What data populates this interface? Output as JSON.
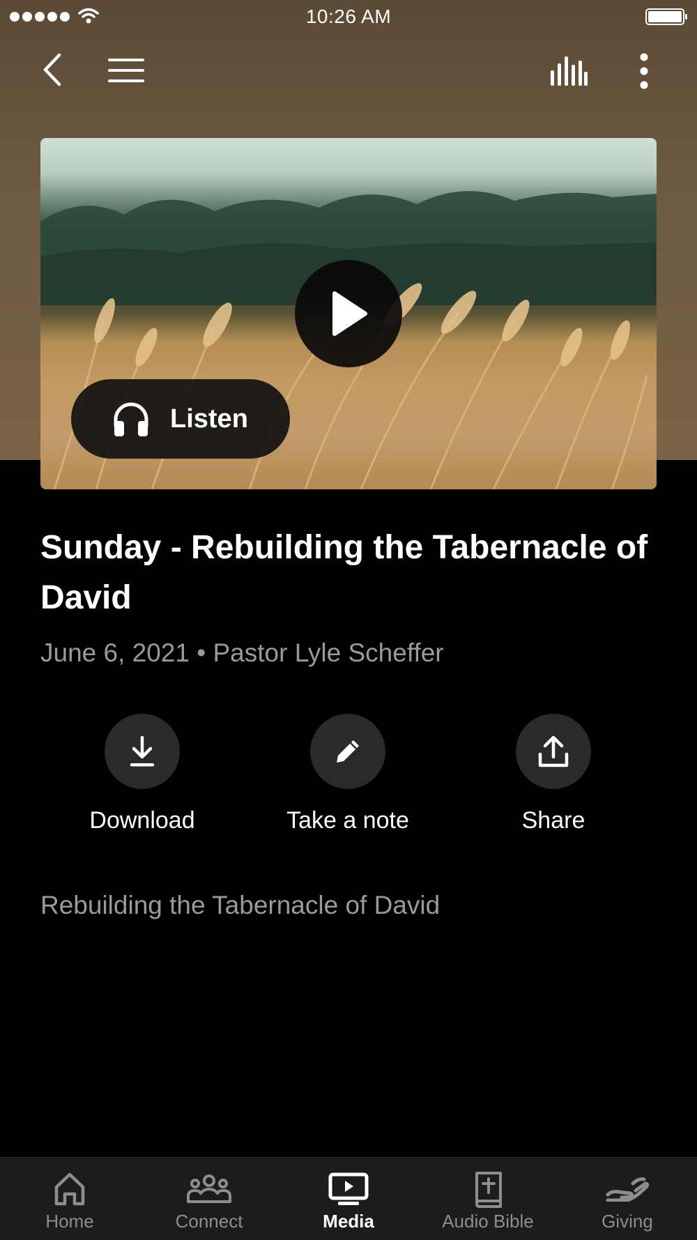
{
  "status_bar": {
    "time": "10:26 AM"
  },
  "top_nav": {
    "back_icon": "chevron-left-icon",
    "menu_icon": "hamburger-icon",
    "audio_icon": "audio-bars-icon",
    "more_icon": "more-vertical-icon"
  },
  "media": {
    "play_icon": "play-icon",
    "listen_label": "Listen",
    "listen_icon": "headphones-icon"
  },
  "sermon": {
    "title": "Sunday - Rebuilding the Tabernacle of David",
    "date": "June 6, 2021",
    "separator": "•",
    "speaker": "Pastor Lyle Scheffer",
    "description": "Rebuilding the Tabernacle of David"
  },
  "actions": [
    {
      "label": "Download",
      "icon": "download-icon"
    },
    {
      "label": "Take a note",
      "icon": "pencil-icon"
    },
    {
      "label": "Share",
      "icon": "share-icon"
    }
  ],
  "tabs": [
    {
      "label": "Home",
      "icon": "home-icon",
      "active": false
    },
    {
      "label": "Connect",
      "icon": "people-icon",
      "active": false
    },
    {
      "label": "Media",
      "icon": "media-icon",
      "active": true
    },
    {
      "label": "Audio Bible",
      "icon": "bible-icon",
      "active": false
    },
    {
      "label": "Giving",
      "icon": "giving-hand-icon",
      "active": false
    }
  ],
  "colors": {
    "header_brown": "#6e5b42",
    "background": "#000000",
    "tabbar": "#1c1c1c",
    "muted_text": "#9a9a9a"
  }
}
